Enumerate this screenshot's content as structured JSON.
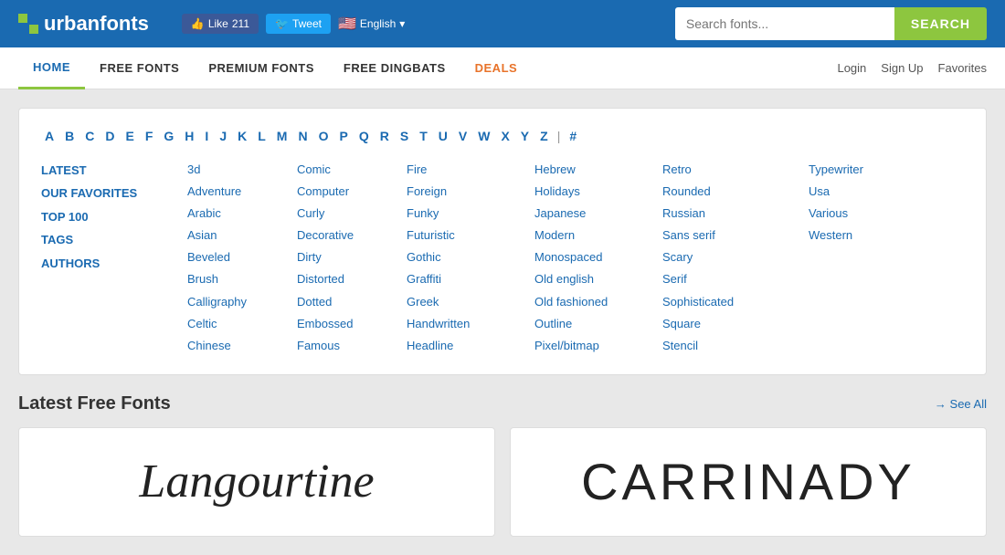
{
  "header": {
    "logo_text": "urbanfonts",
    "like_label": "Like",
    "like_count": "211",
    "tweet_label": "Tweet",
    "lang_label": "English",
    "search_placeholder": "Search fonts...",
    "search_button_label": "SEARCH"
  },
  "nav": {
    "links": [
      {
        "label": "HOME",
        "active": true
      },
      {
        "label": "FREE FONTS",
        "active": false
      },
      {
        "label": "PREMIUM FONTS",
        "active": false
      },
      {
        "label": "FREE DINGBATS",
        "active": false
      },
      {
        "label": "DEALS",
        "active": false,
        "special": true
      }
    ],
    "right_links": [
      {
        "label": "Login"
      },
      {
        "label": "Sign Up"
      },
      {
        "label": "Favorites"
      }
    ]
  },
  "az": {
    "letters": [
      "A",
      "B",
      "C",
      "D",
      "E",
      "F",
      "G",
      "H",
      "I",
      "J",
      "K",
      "L",
      "M",
      "N",
      "O",
      "P",
      "Q",
      "R",
      "S",
      "T",
      "U",
      "V",
      "W",
      "X",
      "Y",
      "Z",
      "#"
    ]
  },
  "special_links": [
    "LATEST",
    "OUR FAVORITES",
    "TOP 100",
    "TAGS",
    "AUTHORS"
  ],
  "categories": {
    "col1": [
      "3d",
      "Adventure",
      "Arabic",
      "Asian",
      "Beveled",
      "Brush",
      "Calligraphy",
      "Celtic",
      "Chinese"
    ],
    "col2": [
      "Comic",
      "Computer",
      "Curly",
      "Decorative",
      "Dirty",
      "Distorted",
      "Dotted",
      "Embossed",
      "Famous"
    ],
    "col3": [
      "Fire",
      "Foreign",
      "Funky",
      "Futuristic",
      "Gothic",
      "Graffiti",
      "Greek",
      "Handwritten",
      "Headline"
    ],
    "col4": [
      "Hebrew",
      "Holidays",
      "Japanese",
      "Modern",
      "Monospaced",
      "Old english",
      "Old fashioned",
      "Outline",
      "Pixel/bitmap"
    ],
    "col5": [
      "Retro",
      "Rounded",
      "Russian",
      "Sans serif",
      "Scary",
      "Serif",
      "Sophisticated",
      "Square",
      "Stencil"
    ],
    "col6": [
      "Typewriter",
      "Usa",
      "Various",
      "Western"
    ]
  },
  "latest_section": {
    "title": "Latest Free Fonts",
    "see_all_label": "→ See All",
    "fonts": [
      {
        "name": "Langourtine",
        "style": "script"
      },
      {
        "name": "CARRINADY",
        "style": "sans"
      }
    ]
  }
}
